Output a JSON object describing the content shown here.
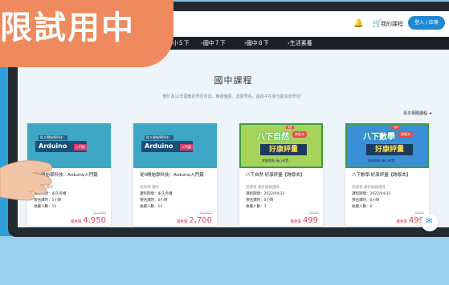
{
  "ribbon": {
    "text": "限試用中"
  },
  "header": {
    "bell_icon": "bell-icon",
    "cart_icon": "cart-icon",
    "my_courses": "我的課程",
    "login": "登入 / 註冊"
  },
  "nav": {
    "items": [
      "小５下",
      "國中７下",
      "國中８下",
      "生活素養"
    ]
  },
  "section": {
    "title": "國中課程",
    "subtitle": "鑒於為12年國教的學習所需，精選優質、連貫學系，讓孩子在家也能高效學習！",
    "more": "更多相關課程 ➔"
  },
  "cards": [
    {
      "kind": "arduino",
      "title": "從0開始學科技：Arduino入門篇",
      "teacher": "程師傅 講師",
      "period": "課程期間：永久有權",
      "duration": "預估課時：5小時",
      "students": "收藏人數：15",
      "orig": "$5,000",
      "price_label": "優惠價",
      "price": "4,950",
      "thumb": {
        "small": "從０開始學科技：",
        "banner": "Arduino",
        "tag": "入門篇"
      }
    },
    {
      "kind": "arduino",
      "title": "從0開始學科技：Arduino入門篇",
      "teacher": "程師傅 講師",
      "period": "課程期間：永久有權",
      "duration": "預估課時：0小時",
      "students": "收藏人數：13",
      "orig": "$3,000",
      "price_label": "優惠價",
      "price": "2,700",
      "thumb": {
        "small": "從０開始學科技：",
        "banner": "Arduino",
        "tag": "入門篇"
      }
    },
    {
      "kind": "sci",
      "title": "八下自然 好康評量【跨版本】",
      "teacher": "授課者 康軒編輯團隊",
      "period": "課程期間：2022/04/32",
      "duration": "預估課時：0小時",
      "students": "收藏人數：3",
      "orig": "$600",
      "price_label": "優惠價",
      "price": "499",
      "thumb": {
        "big": "八下自然",
        "pill": "跨版本",
        "hl": "好康評量",
        "brand": "康軒",
        "foot": "掌握重點 精心佈置"
      }
    },
    {
      "kind": "math",
      "title": "八下數學 好康評量【跨版本】",
      "teacher": "授課者 康軒編輯團隊",
      "period": "課程期間：2022/04/32",
      "duration": "預估課時：0小時",
      "students": "收藏人數：6",
      "orig": "$600",
      "price_label": "優惠價",
      "price": "499",
      "thumb": {
        "big": "八下數學",
        "pill": "跨版本",
        "hl": "好康評量",
        "brand": "康軒",
        "foot": "掌握重點 精心佈置"
      }
    }
  ]
}
